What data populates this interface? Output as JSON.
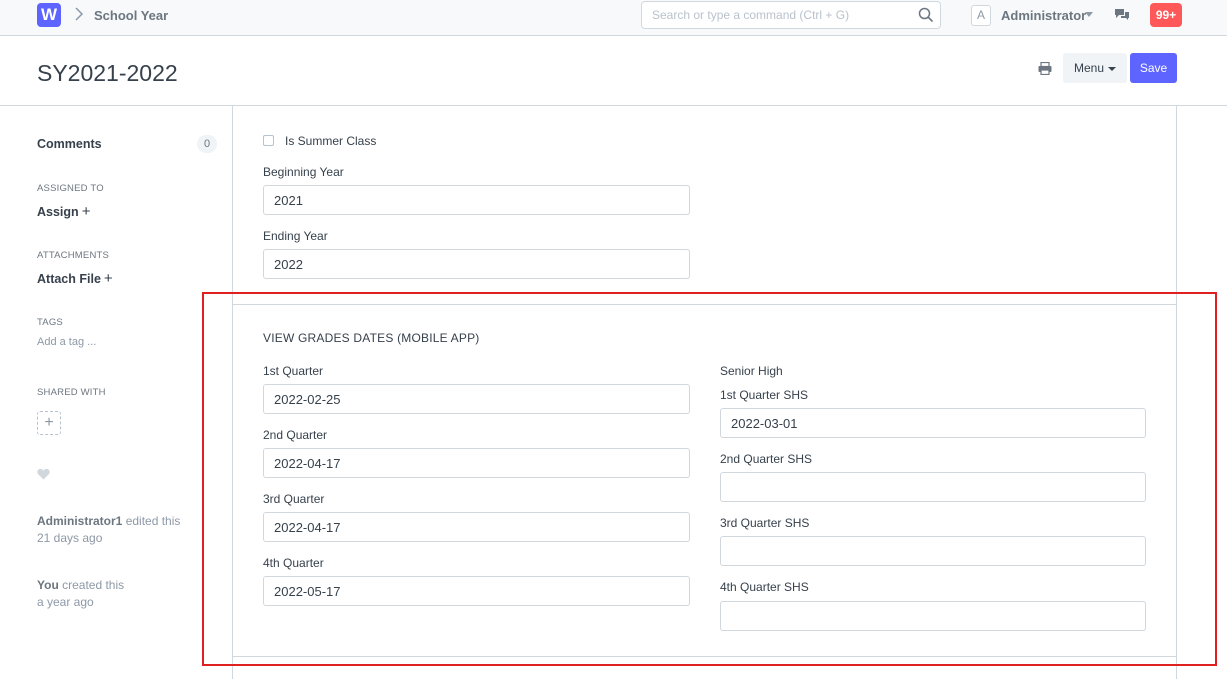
{
  "navbar": {
    "logo": "W",
    "breadcrumb": "School Year",
    "search_placeholder": "Search or type a command (Ctrl + G)",
    "avatar_letter": "A",
    "user_name": "Administrator",
    "notification_count": "99+"
  },
  "page": {
    "title": "SY2021-2022",
    "menu_label": "Menu",
    "save_label": "Save"
  },
  "sidebar": {
    "comments_label": "Comments",
    "comments_count": "0",
    "assigned_to_label": "ASSIGNED TO",
    "assign_label": "Assign",
    "attachments_label": "ATTACHMENTS",
    "attach_label": "Attach File",
    "tags_label": "TAGS",
    "add_tag": "Add a tag ...",
    "shared_with_label": "SHARED WITH",
    "activity": [
      {
        "actor": "Administrator1",
        "action": " edited this",
        "when": "21 days ago"
      },
      {
        "actor": "You",
        "action": " created this",
        "when": "a year ago"
      }
    ]
  },
  "form": {
    "summer_class_label": "Is Summer Class",
    "beginning_year_label": "Beginning Year",
    "beginning_year_value": "2021",
    "ending_year_label": "Ending Year",
    "ending_year_value": "2022",
    "section_title": "VIEW GRADES DATES (MOBILE APP)",
    "quarters": [
      {
        "label": "1st Quarter",
        "value": "2022-02-25"
      },
      {
        "label": "2nd Quarter",
        "value": "2022-04-17"
      },
      {
        "label": "3rd Quarter",
        "value": "2022-04-17"
      },
      {
        "label": "4th Quarter",
        "value": "2022-05-17"
      }
    ],
    "senior_high_label": "Senior High",
    "shs_quarters": [
      {
        "label": "1st Quarter SHS",
        "value": "2022-03-01"
      },
      {
        "label": "2nd Quarter SHS",
        "value": ""
      },
      {
        "label": "3rd Quarter SHS",
        "value": ""
      },
      {
        "label": "4th Quarter SHS",
        "value": ""
      }
    ]
  },
  "colors": {
    "accent": "#5e64ff",
    "notification": "#ff5858",
    "highlight": "#e02020"
  }
}
